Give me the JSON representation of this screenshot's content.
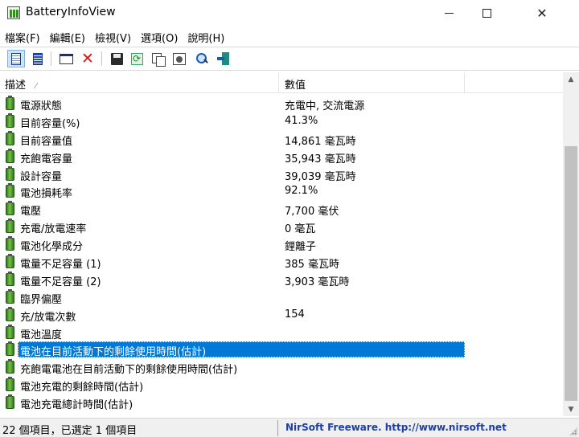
{
  "window": {
    "title": "BatteryInfoView"
  },
  "menu": [
    "檔案(F)",
    "編輯(E)",
    "檢視(V)",
    "選項(O)",
    "說明(H)"
  ],
  "toolbar": {
    "icons": [
      "html-report-icon",
      "view-mode-icon",
      "window-icon",
      "delete-icon",
      "save-icon",
      "refresh-icon",
      "copy-icon",
      "properties-icon",
      "find-icon",
      "exit-icon"
    ]
  },
  "list": {
    "columns": {
      "description": "描述",
      "value": "數值"
    },
    "rows": [
      {
        "label": "電源狀態",
        "value": "充電中, 交流電源"
      },
      {
        "label": "目前容量(%)",
        "value": "41.3%"
      },
      {
        "label": "目前容量值",
        "value": "14,861 毫瓦時"
      },
      {
        "label": "充飽電容量",
        "value": "35,943 毫瓦時"
      },
      {
        "label": "設計容量",
        "value": "39,039 毫瓦時"
      },
      {
        "label": "電池損耗率",
        "value": "92.1%"
      },
      {
        "label": "電壓",
        "value": "7,700 毫伏"
      },
      {
        "label": "充電/放電速率",
        "value": "0 毫瓦"
      },
      {
        "label": "電池化學成分",
        "value": "鋰離子"
      },
      {
        "label": "電量不足容量 (1)",
        "value": "385 毫瓦時"
      },
      {
        "label": "電量不足容量 (2)",
        "value": "3,903 毫瓦時"
      },
      {
        "label": "臨界偏壓",
        "value": ""
      },
      {
        "label": "充/放電次數",
        "value": "154"
      },
      {
        "label": "電池溫度",
        "value": ""
      },
      {
        "label": "電池在目前活動下的剩餘使用時間(估計)",
        "value": "",
        "selected": true
      },
      {
        "label": "充飽電電池在目前活動下的剩餘使用時間(估計)",
        "value": ""
      },
      {
        "label": "電池充電的剩餘時間(估計)",
        "value": ""
      },
      {
        "label": "電池充電總計時間(估計)",
        "value": ""
      }
    ]
  },
  "status": {
    "items": "22 個項目，已選定 1 個項目",
    "credit": "NirSoft Freeware.  http://www.nirsoft.net"
  }
}
